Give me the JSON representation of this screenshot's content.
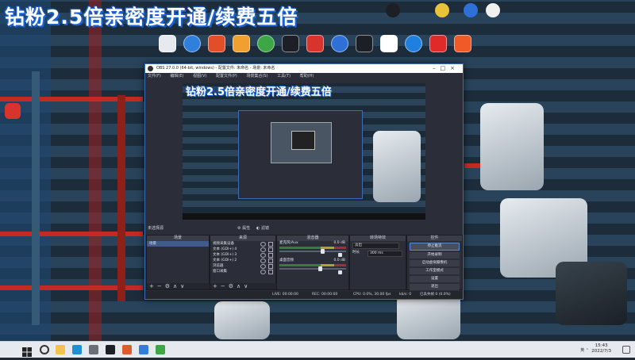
{
  "banner": {
    "text": "钻粉2.5倍亲密度开通/续费五倍"
  },
  "desktop": {
    "icons": [
      {
        "name": "app-shortcut-1",
        "color": "#e6e9ee"
      },
      {
        "name": "app-shortcut-2",
        "color": "#2f7fdc"
      },
      {
        "name": "app-shortcut-3",
        "color": "#e04e2a"
      },
      {
        "name": "app-shortcut-4",
        "color": "#f0a030"
      },
      {
        "name": "chrome-icon",
        "color": "#3ca744"
      },
      {
        "name": "obs-icon",
        "color": "#1d1f26"
      },
      {
        "name": "app-shortcut-7",
        "color": "#d8332d"
      },
      {
        "name": "app-shortcut-8",
        "color": "#2f6fd8"
      },
      {
        "name": "app-shortcut-9",
        "color": "#1d1f26"
      },
      {
        "name": "app-shortcut-10",
        "color": "#ffffff"
      },
      {
        "name": "kugou-icon",
        "color": "#2080e0"
      },
      {
        "name": "netease-music-icon",
        "color": "#e02a2a"
      },
      {
        "name": "app-shortcut-13",
        "color": "#f05a28"
      }
    ]
  },
  "obs": {
    "title": "OBS 27.0.0 (64-bit, windows) - 配置文件: 未命名 - 场景: 未命名",
    "menu": [
      "文件(F)",
      "编辑(E)",
      "视图(V)",
      "配置文件(P)",
      "场景集合(S)",
      "工具(T)",
      "帮助(H)"
    ],
    "preview_title": "钻粉2.5倍亲密度开通/续费五倍",
    "scene_toolbar": {
      "label": "未选择源",
      "props": "属性",
      "filters": "滤镜"
    },
    "docks": {
      "scenes": {
        "title": "场景",
        "items": [
          "场景"
        ]
      },
      "sources": {
        "title": "来源",
        "items": [
          "视频采集设备",
          "文本 (GDI+) 4",
          "文本 (GDI+) 3",
          "文本 (GDI+) 2",
          "浏览器",
          "窗口采集"
        ]
      },
      "mixer": {
        "title": "混音器",
        "channels": [
          {
            "name": "麦克风/Aux",
            "db": "0.0 dB",
            "level": 0.62
          },
          {
            "name": "桌面音频",
            "db": "0.0 dB",
            "level": 0.58
          }
        ]
      },
      "transitions": {
        "title": "转场特效",
        "type": "淡出",
        "duration_label": "时长",
        "duration": "300 ms"
      },
      "controls": {
        "title": "控件",
        "buttons": [
          "停止推流",
          "开始录制",
          "启动虚拟摄像机",
          "工作室模式",
          "设置",
          "退出"
        ]
      }
    },
    "status": {
      "live": "LIVE: 00:00:00",
      "rec": "REC: 00:00:00",
      "cpu": "CPU: 0.0%, 30.00 fps",
      "kbps": "kb/s: 0",
      "dropped": "已丢失帧 0 (0.0%)"
    }
  },
  "taskbar": {
    "apps": [
      {
        "name": "file-explorer-icon",
        "color": "#f2c24a"
      },
      {
        "name": "edge-icon",
        "color": "#1f8fd6"
      },
      {
        "name": "settings-icon",
        "color": "#6a6f78"
      },
      {
        "name": "obs-taskbar-icon",
        "color": "#1d1f26"
      },
      {
        "name": "taskbar-app-5",
        "color": "#e05a2a"
      },
      {
        "name": "taskbar-app-6",
        "color": "#2f7fdc"
      },
      {
        "name": "chrome-taskbar-icon",
        "color": "#3ca744"
      }
    ],
    "tray_text": "英 ⌃",
    "time": "15:43",
    "date": "2022/7/3"
  },
  "colors": {
    "accent": "#3b6db5",
    "banner_shadow": "#1b63d8",
    "obs_bg": "#2b2e38"
  }
}
